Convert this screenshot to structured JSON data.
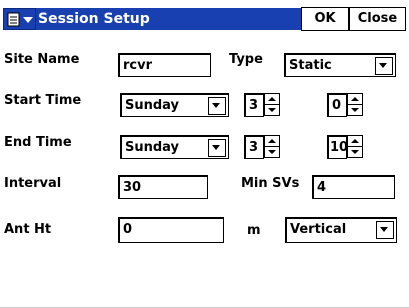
{
  "window": {
    "title": "Session Setup",
    "ok_label": "OK",
    "close_label": "Close"
  },
  "form": {
    "site_name": {
      "label": "Site Name",
      "value": "rcvr"
    },
    "type": {
      "label": "Type",
      "value": "Static"
    },
    "start_time": {
      "label": "Start Time",
      "day": "Sunday",
      "hour": "3",
      "minute": "0"
    },
    "end_time": {
      "label": "End Time",
      "day": "Sunday",
      "hour": "3",
      "minute": "10"
    },
    "interval": {
      "label": "Interval",
      "value": "30"
    },
    "min_svs": {
      "label": "Min SVs",
      "value": "4"
    },
    "ant_ht": {
      "label": "Ant Ht",
      "value": "0",
      "unit": "m",
      "method": "Vertical"
    }
  },
  "icons": {
    "menu": "start-menu-icon",
    "dropdown": "chevron-down-icon",
    "spin_up": "triangle-up-icon",
    "spin_down": "triangle-down-icon"
  },
  "colors": {
    "titlebar": "#1840b0",
    "title_text": "#ffffff"
  }
}
